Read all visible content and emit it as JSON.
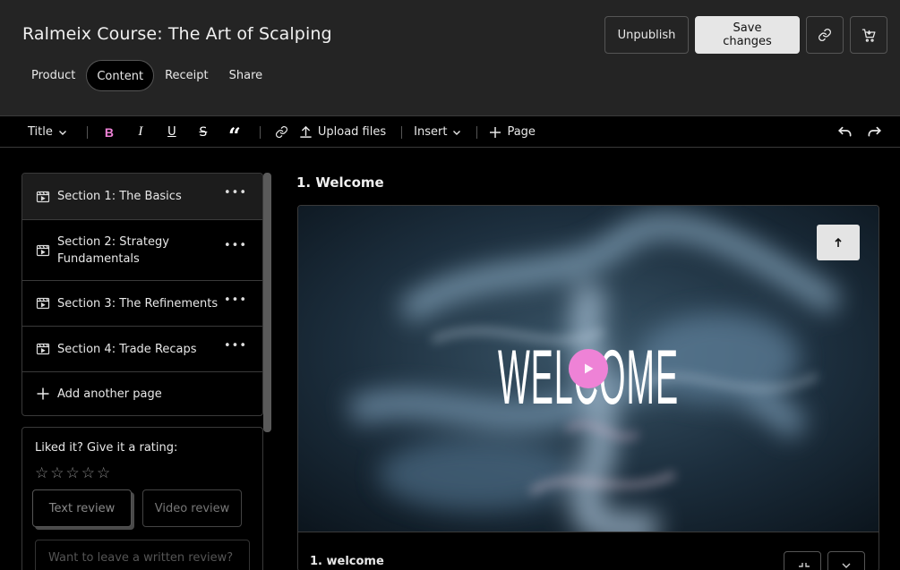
{
  "header": {
    "title": "Ralmeix Course: The Art of Scalping",
    "tabs": [
      {
        "label": "Product"
      },
      {
        "label": "Content"
      },
      {
        "label": "Receipt"
      },
      {
        "label": "Share"
      }
    ],
    "active_tab": "Content",
    "unpublish_label": "Unpublish",
    "save_label": "Save changes"
  },
  "toolbar": {
    "title_label": "Title",
    "upload_label": "Upload files",
    "insert_label": "Insert",
    "page_label": "Page"
  },
  "sidebar": {
    "sections": [
      {
        "label": "Section 1: The Basics"
      },
      {
        "label": "Section 2: Strategy Fundamentals"
      },
      {
        "label": "Section 3: The Refinements"
      },
      {
        "label": "Section 4: Trade Recaps"
      }
    ],
    "add_label": "Add another page"
  },
  "rating": {
    "question": "Liked it? Give it a rating:",
    "stars": 0,
    "text_review_label": "Text review",
    "video_review_label": "Video review",
    "review_placeholder": "Want to leave a written review?"
  },
  "main": {
    "title": "1. Welcome",
    "video_text": "WELCOME",
    "video_name": "1. welcome"
  },
  "colors": {
    "accent": "#ee82d6",
    "header_bg": "#242424",
    "page_bg": "#000000"
  }
}
